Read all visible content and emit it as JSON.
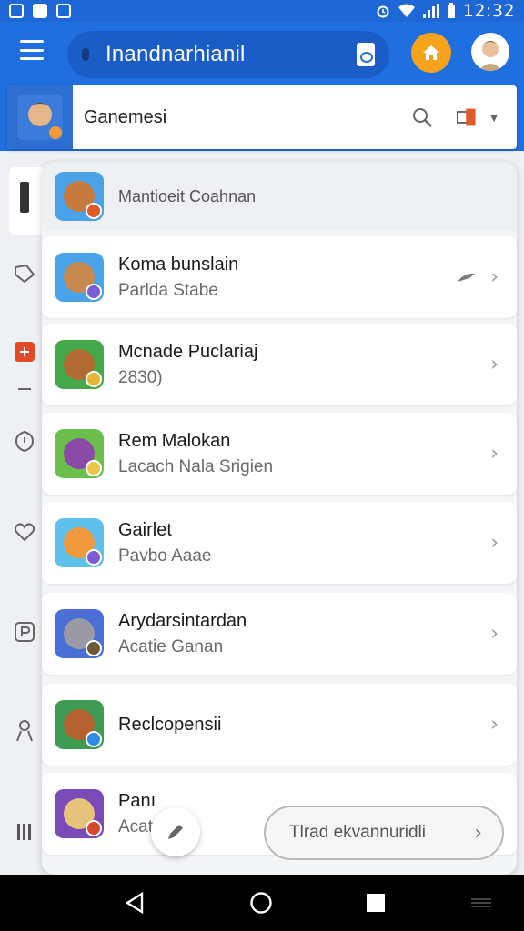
{
  "status_bar": {
    "time": "12:32",
    "colors": {
      "bar": "#1d67d6"
    }
  },
  "app_bar": {
    "search_text": "Inandnarhianil",
    "menu_icon": "menu-icon",
    "home_icon": "home-icon",
    "avatar_icon": "avatar-icon",
    "colors": {
      "bar": "#1f6fe0",
      "home": "#f7a21b"
    }
  },
  "header": {
    "title": "Ganemesi",
    "search_icon": "search-icon",
    "device_icon": "device-icon",
    "dropdown_icon": "chevron-down-icon"
  },
  "rail": {
    "items": [
      "grid-icon",
      "tag-icon",
      "badge-icon",
      "shield-icon",
      "heart-icon",
      "parking-icon",
      "person-icon",
      "bars-icon"
    ]
  },
  "sheet": {
    "title": "Mantioeit Coahnan",
    "items": [
      {
        "name": "Koma bunslain",
        "sub": "Parlda Stabe",
        "thumb": "#4aa3e8",
        "face": "#c6894e",
        "dot": "#7c5cd6",
        "extra": "bird-icon"
      },
      {
        "name": "Mcnade Puclariaj",
        "sub": "2830)",
        "thumb": "#45a84a",
        "face": "#b36b33",
        "dot": "#e7b534",
        "extra": ""
      },
      {
        "name": "Rem Malokan",
        "sub": "Lacach Nala Srigien",
        "thumb": "#6ac04a",
        "face": "#8c4aa8",
        "dot": "#e7c64a",
        "extra": ""
      },
      {
        "name": "Gairlet",
        "sub": "Pavbo Aaae",
        "thumb": "#5fc0ec",
        "face": "#f29a3b",
        "dot": "#7c5cd6",
        "extra": ""
      },
      {
        "name": "Arydarsintardan",
        "sub": "Acatie Ganan",
        "thumb": "#4b6fd6",
        "face": "#9a9aa4",
        "dot": "#6b5a3a",
        "extra": ""
      },
      {
        "name": "Reclcopensii",
        "sub": "",
        "thumb": "#3f9b52",
        "face": "#b3622f",
        "dot": "#2c8ee0",
        "extra": ""
      },
      {
        "name": "Panı",
        "sub": "Acat",
        "thumb": "#7a4bb6",
        "face": "#e6c27a",
        "dot": "#d9472b",
        "extra": ""
      }
    ],
    "colors": {
      "row_bg": "#ffffff",
      "sheet_bg": "#f4f5f7"
    }
  },
  "cta": {
    "label": "Tlrad ekvannuridli",
    "chevron": "›"
  },
  "edit_icon": "pencil-icon",
  "nav": {
    "back": "back-icon",
    "home": "home-circle-icon",
    "recents": "recents-icon",
    "menu": "menu-lines-icon"
  }
}
